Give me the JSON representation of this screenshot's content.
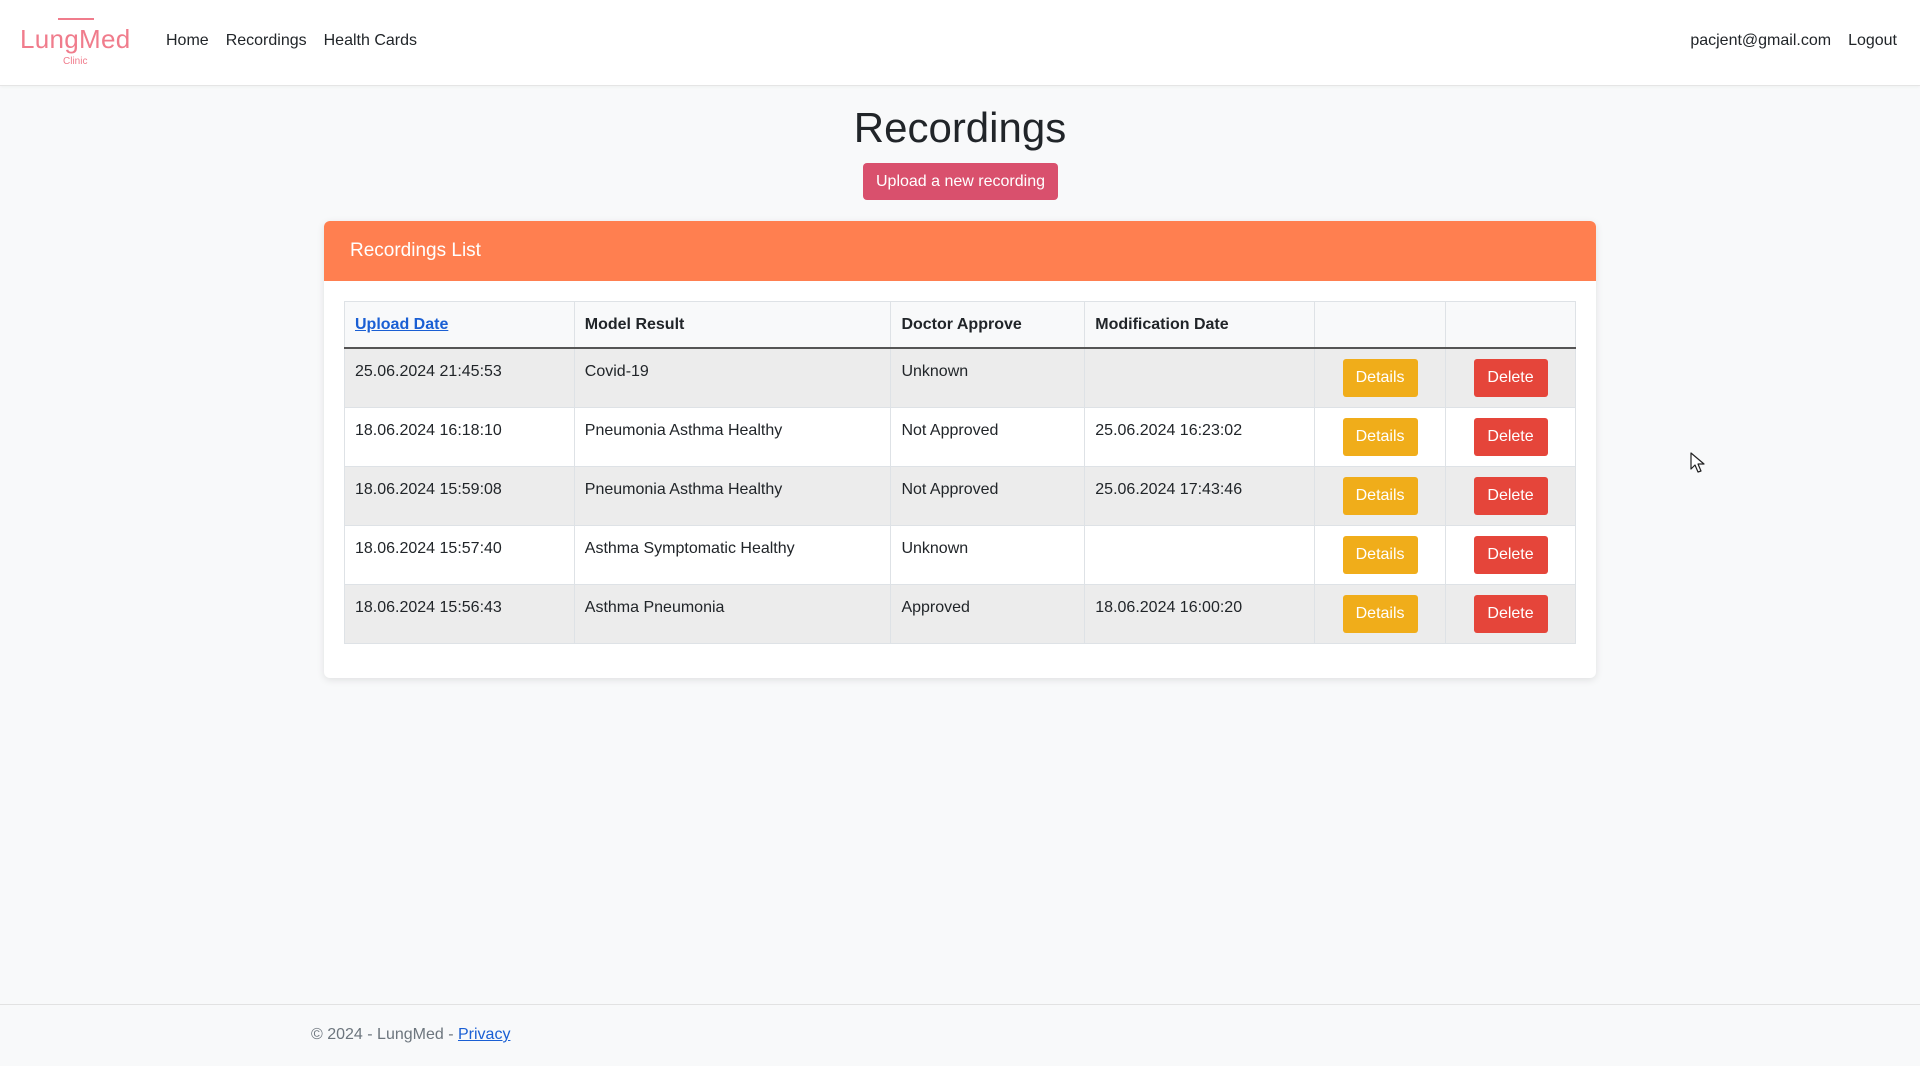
{
  "brand": {
    "name": "LungMed",
    "subtitle": "Clinic"
  },
  "nav": {
    "links": [
      "Home",
      "Recordings",
      "Health Cards"
    ],
    "user_email": "pacjent@gmail.com",
    "logout": "Logout"
  },
  "page": {
    "title": "Recordings",
    "upload_button": "Upload a new recording"
  },
  "card": {
    "title": "Recordings List",
    "columns": [
      "Upload Date",
      "Model Result",
      "Doctor Approve",
      "Modification Date",
      "",
      ""
    ],
    "details_label": "Details",
    "delete_label": "Delete",
    "rows": [
      {
        "upload_date": "25.06.2024 21:45:53",
        "model_result": "Covid-19",
        "doctor_approve": "Unknown",
        "modification_date": ""
      },
      {
        "upload_date": "18.06.2024 16:18:10",
        "model_result": "Pneumonia Asthma Healthy",
        "doctor_approve": "Not Approved",
        "modification_date": "25.06.2024 16:23:02"
      },
      {
        "upload_date": "18.06.2024 15:59:08",
        "model_result": "Pneumonia Asthma Healthy",
        "doctor_approve": "Not Approved",
        "modification_date": "25.06.2024 17:43:46"
      },
      {
        "upload_date": "18.06.2024 15:57:40",
        "model_result": "Asthma Symptomatic Healthy",
        "doctor_approve": "Unknown",
        "modification_date": ""
      },
      {
        "upload_date": "18.06.2024 15:56:43",
        "model_result": "Asthma Pneumonia",
        "doctor_approve": "Approved",
        "modification_date": "18.06.2024 16:00:20"
      }
    ]
  },
  "footer": {
    "text": "© 2024 - LungMed - ",
    "privacy": "Privacy"
  },
  "colors": {
    "brand": "#f07c8c",
    "card_header": "#ff7f50",
    "upload_button": "#d9506d",
    "details_button": "#f0ad1a",
    "delete_button": "#e5453a",
    "link": "#1a5fd4"
  },
  "icons": {
    "cursor": "mouse-pointer-icon"
  }
}
